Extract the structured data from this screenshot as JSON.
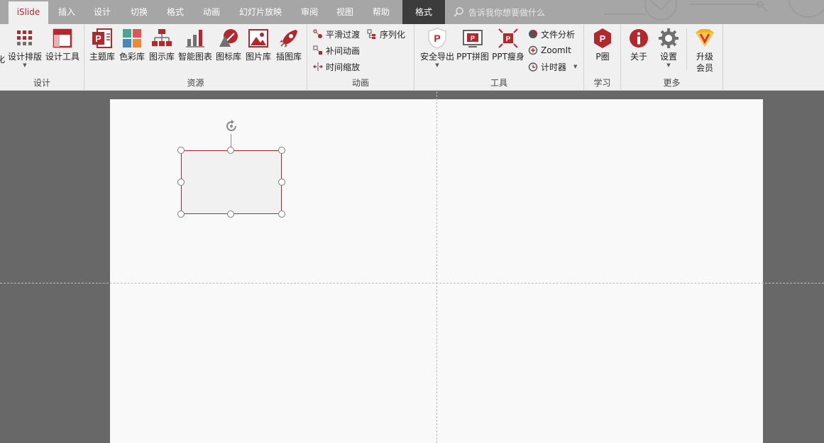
{
  "tabs": [
    {
      "label": "iSlide",
      "state": "active"
    },
    {
      "label": "插入"
    },
    {
      "label": "设计"
    },
    {
      "label": "切换"
    },
    {
      "label": "格式"
    },
    {
      "label": "动画"
    },
    {
      "label": "幻灯片放映"
    },
    {
      "label": "审阅"
    },
    {
      "label": "视图"
    },
    {
      "label": "帮助"
    },
    {
      "label": "格式",
      "state": "context"
    }
  ],
  "search": {
    "placeholder": "告诉我你想要做什么"
  },
  "ribbon": {
    "design": {
      "label": "设计",
      "items": [
        {
          "label": "化"
        },
        {
          "label": "设计排版",
          "icon": "grid-layout-icon"
        },
        {
          "label": "设计工具",
          "icon": "design-tool-icon"
        }
      ]
    },
    "resources": {
      "label": "资源",
      "items": [
        {
          "label": "主题库",
          "icon": "theme-library-icon"
        },
        {
          "label": "色彩库",
          "icon": "color-library-icon"
        },
        {
          "label": "图示库",
          "icon": "diagram-library-icon"
        },
        {
          "label": "智能图表",
          "icon": "smart-chart-icon"
        },
        {
          "label": "图标库",
          "icon": "icon-library-icon"
        },
        {
          "label": "图片库",
          "icon": "picture-library-icon"
        },
        {
          "label": "插图库",
          "icon": "illustration-library-icon"
        }
      ]
    },
    "animation": {
      "label": "动画",
      "items": [
        {
          "label": "平滑过渡",
          "icon": "smooth-transition-icon"
        },
        {
          "label": "序列化",
          "icon": "serialize-icon"
        },
        {
          "label": "补间动画",
          "icon": "tween-animation-icon"
        },
        {
          "label": "时间缩放",
          "icon": "time-scale-icon"
        }
      ]
    },
    "tools": {
      "label": "工具",
      "items": [
        {
          "label": "安全导出",
          "icon": "safe-export-icon"
        },
        {
          "label": "PPT拼图",
          "icon": "ppt-collage-icon"
        },
        {
          "label": "PPT瘦身",
          "icon": "ppt-slim-icon"
        },
        {
          "label": "文件分析",
          "icon": "file-analysis-icon"
        },
        {
          "label": "ZoomIt",
          "icon": "zoomit-icon"
        },
        {
          "label": "计时器",
          "icon": "timer-icon"
        }
      ]
    },
    "learn": {
      "label": "学习",
      "items": [
        {
          "label": "P圈",
          "icon": "p-circle-icon"
        }
      ]
    },
    "more": {
      "label": "更多",
      "items": [
        {
          "label": "关于",
          "icon": "info-icon"
        },
        {
          "label": "设置",
          "icon": "gear-icon"
        },
        {
          "label": "升级\n会员",
          "line1": "升级",
          "line2": "会员",
          "icon": "vip-badge-icon"
        }
      ]
    }
  },
  "colors": {
    "accent": "#b2282c",
    "tabbar": "#a6a6a6",
    "ribbon": "#f0f0f0",
    "workspace": "#686868",
    "slide": "#f9f9f9"
  }
}
